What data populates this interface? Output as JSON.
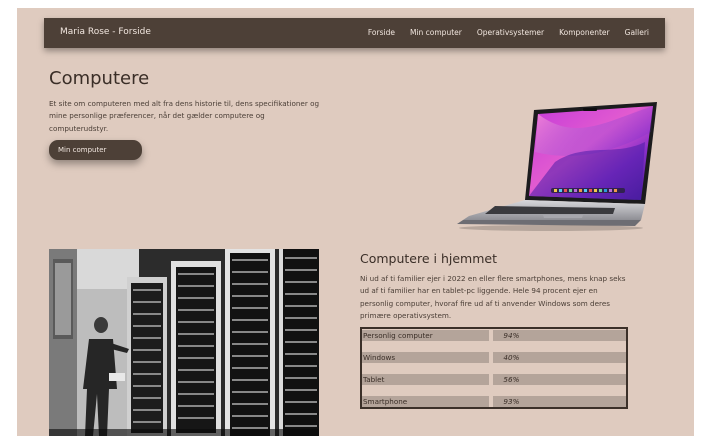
{
  "nav": {
    "brand": "Maria Rose - Forside",
    "links": [
      "Forside",
      "Min computer",
      "Operativsystemer",
      "Komponenter",
      "Galleri"
    ]
  },
  "hero": {
    "title": "Computere",
    "text": "Et site om computeren med alt fra dens historie til, dens specifikationer og mine personlige præferencer, når det gælder computere og computerudstyr.",
    "button_label": "Min computer"
  },
  "home": {
    "title": "Computere i hjemmet",
    "text": "Ni ud af ti familier ejer i 2022 en eller flere smartphones, mens knap seks ud af ti familier har en tablet-pc liggende. Hele 94 procent ejer en personlig computer, hvoraf fire ud af ti anvender Windows som deres primære operativsystem.",
    "table": [
      {
        "label": "Personlig computer",
        "value": "94%"
      },
      {
        "label": "Windows",
        "value": "40%"
      },
      {
        "label": "Tablet",
        "value": "56%"
      },
      {
        "label": "Smartphone",
        "value": "93%"
      }
    ]
  },
  "colors": {
    "background": "#dfcbbf",
    "nav": "#4d4037",
    "row": "#b4a49a",
    "text": "#3a2e27"
  }
}
